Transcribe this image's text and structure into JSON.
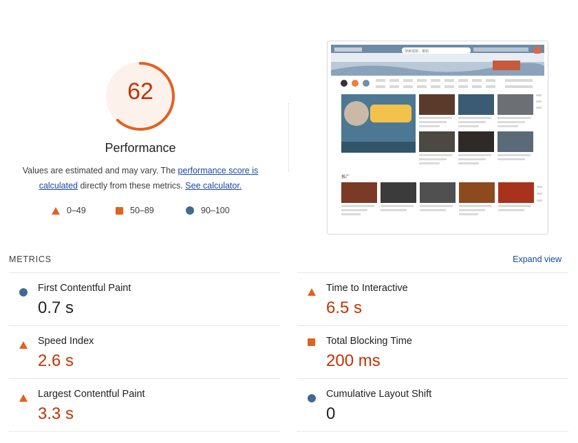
{
  "performance": {
    "score": "62",
    "score_fraction": 0.62,
    "title": "Performance",
    "desc_prefix": "Values are estimated and may vary. The ",
    "desc_link1": "performance score is calculated",
    "desc_mid": " directly from these metrics. ",
    "desc_link2": "See calculator.",
    "gauge_color": "#e2611f",
    "gauge_bg": "#fdf1ec"
  },
  "legend": [
    {
      "symbol": "triangle",
      "label": "0–49",
      "color": "#e2611f"
    },
    {
      "symbol": "square",
      "label": "50–89",
      "color": "#e2611f"
    },
    {
      "symbol": "circle",
      "label": "90–100",
      "color": "#3f6b93"
    }
  ],
  "metrics": {
    "heading": "METRICS",
    "expand_label": "Expand view",
    "items": [
      {
        "name": "First Contentful Paint",
        "value": "0.7 s",
        "rating": "good"
      },
      {
        "name": "Time to Interactive",
        "value": "6.5 s",
        "rating": "poor"
      },
      {
        "name": "Speed Index",
        "value": "2.6 s",
        "rating": "poor"
      },
      {
        "name": "Total Blocking Time",
        "value": "200 ms",
        "rating": "average"
      },
      {
        "name": "Largest Contentful Paint",
        "value": "3.3 s",
        "rating": "poor"
      },
      {
        "name": "Cumulative Layout Shift",
        "value": "0",
        "rating": "good"
      }
    ]
  },
  "screenshot": {
    "search_placeholder": "搜索视频、番剧",
    "section_label": "推广"
  },
  "colors": {
    "poor": "#c33300",
    "average_icon": "#e2611f",
    "good_icon": "#3f6b93",
    "link": "#1a46a8"
  }
}
